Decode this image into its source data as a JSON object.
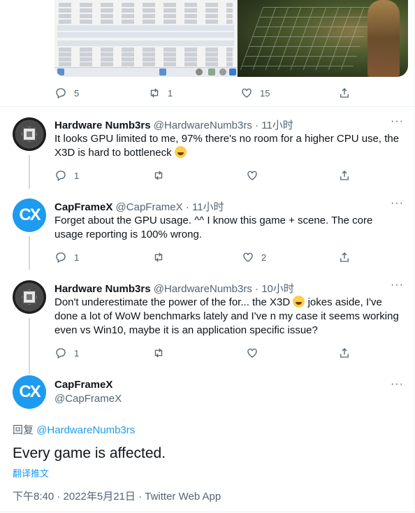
{
  "top_tweet": {
    "reply_count": "5",
    "retweet_count": "1",
    "like_count": "15"
  },
  "replies": [
    {
      "name": "Hardware Numb3rs",
      "handle": "@HardwareNumb3rs",
      "time": "11小时",
      "text_before": "It looks GPU limited to me, 97% there's no room for a higher CPU use, the X3D is hard to bottleneck",
      "text_after": "",
      "reply_count": "1",
      "retweet_count": "",
      "like_count": ""
    },
    {
      "name": "CapFrameX",
      "handle": "@CapFrameX",
      "time": "11小时",
      "text_before": "Forget about the GPU usage. ^^ I know this game + scene. The core usage reporting is 100% wrong.",
      "text_after": "",
      "reply_count": "1",
      "retweet_count": "",
      "like_count": "2"
    },
    {
      "name": "Hardware Numb3rs",
      "handle": "@HardwareNumb3rs",
      "time": "10小时",
      "text_before": "Don't underestimate the power of the for... the X3D",
      "text_after": "jokes aside, I've done a lot of WoW benchmarks lately and I've n my case it seems working even vs Win10, maybe it is an application specific issue?",
      "reply_count": "1",
      "retweet_count": "",
      "like_count": ""
    }
  ],
  "main_tweet": {
    "name": "CapFrameX",
    "handle": "@CapFrameX",
    "reply_prefix": "回复",
    "reply_to": "@HardwareNumb3rs",
    "text": "Every game is affected.",
    "translate": "翻译推文",
    "timestamp": "下午8:40 · 2022年5月21日 · Twitter Web App"
  },
  "more_glyph": "···",
  "avatar_cx_text": "CX",
  "colors": {
    "accent": "#1d9bf0",
    "muted": "#536471",
    "text": "#0f1419"
  },
  "icons": [
    "reply-icon",
    "retweet-icon",
    "like-icon",
    "share-icon",
    "more-icon"
  ]
}
